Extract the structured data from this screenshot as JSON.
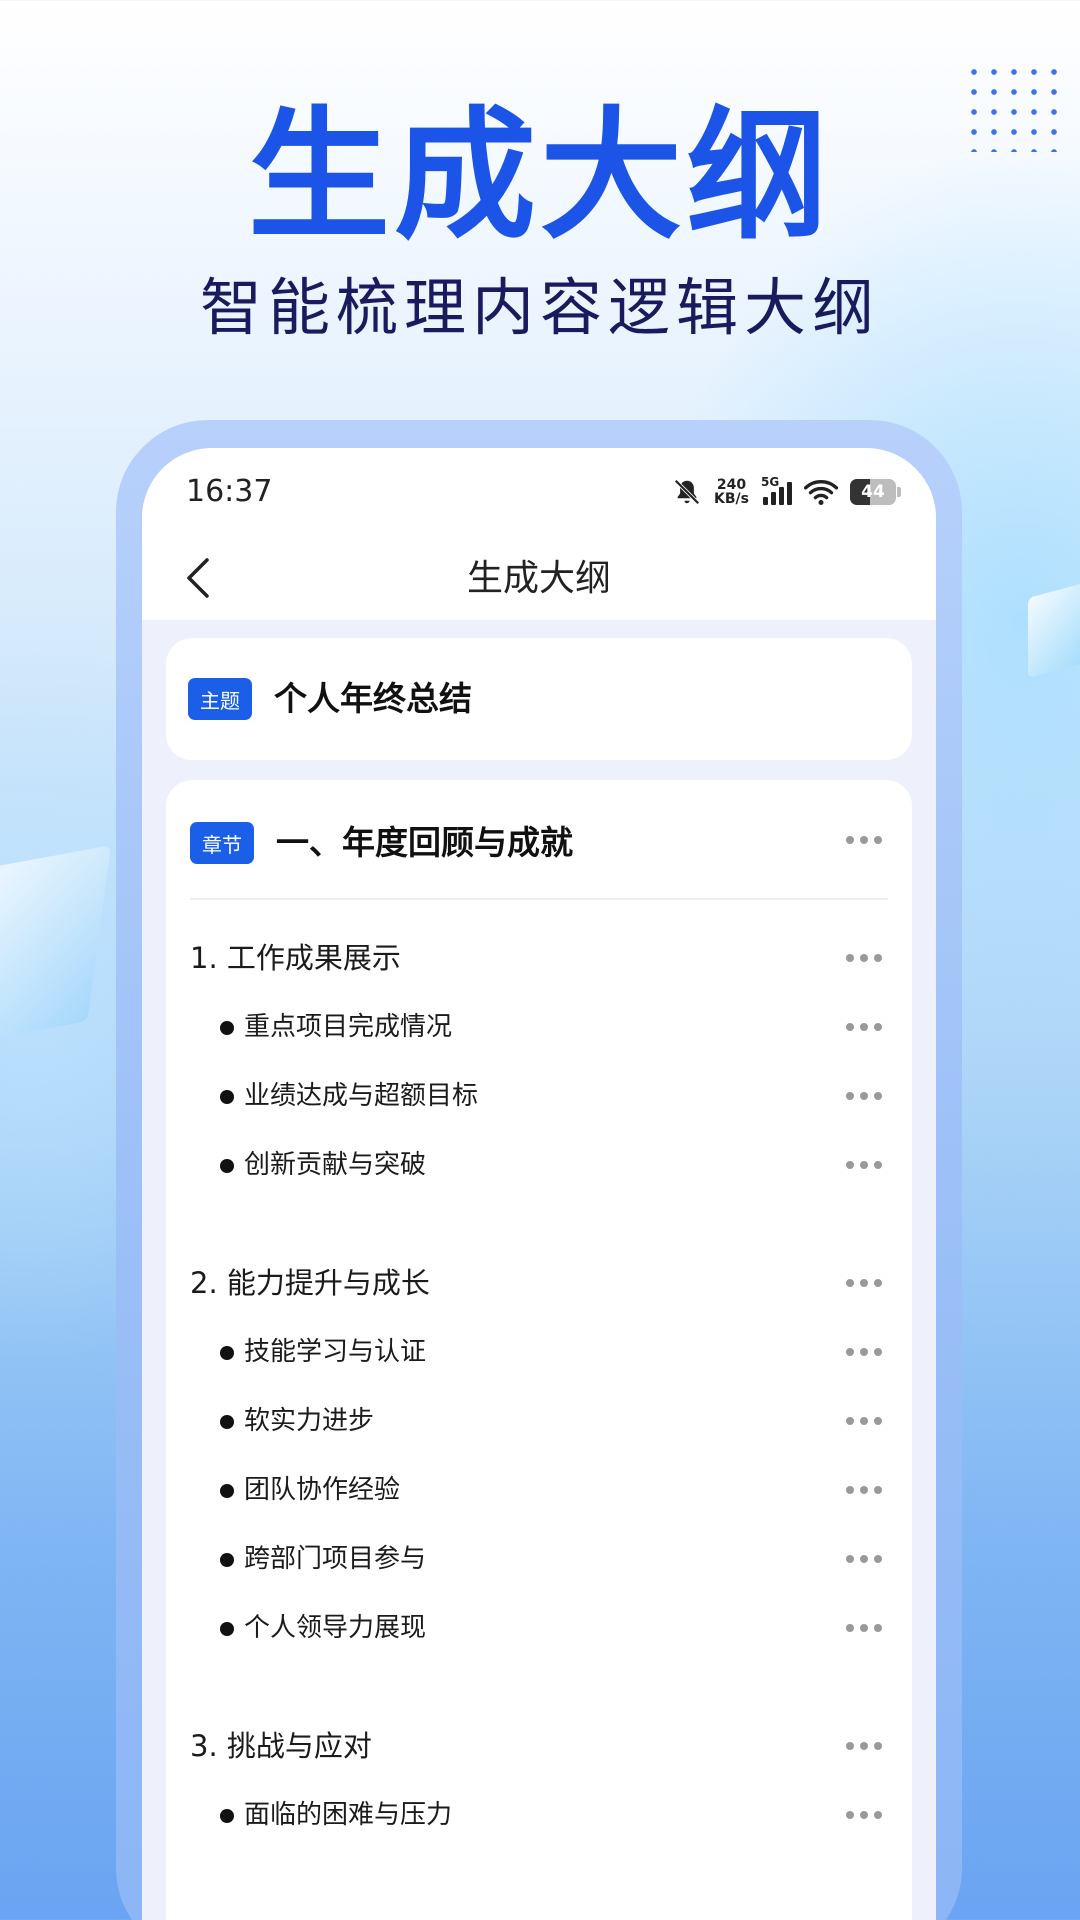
{
  "hero": {
    "title": "生成大纲",
    "subtitle": "智能梳理内容逻辑大纲"
  },
  "status_bar": {
    "time": "16:37",
    "net_speed_value": "240",
    "net_speed_unit": "KB/s",
    "network": "5G",
    "battery": "44",
    "icons": [
      "bell-muted-icon",
      "signal-icon",
      "wifi-icon",
      "battery-icon"
    ]
  },
  "nav": {
    "back_icon": "chevron-left-icon",
    "title": "生成大纲"
  },
  "topic": {
    "tag": "主题",
    "text": "个人年终总结"
  },
  "chapter": {
    "tag": "章节",
    "title": "一、年度回顾与成就",
    "sections": [
      {
        "label": "1. 工作成果展示",
        "items": [
          "重点项目完成情况",
          "业绩达成与超额目标",
          "创新贡献与突破"
        ]
      },
      {
        "label": "2. 能力提升与成长",
        "items": [
          "技能学习与认证",
          "软实力进步",
          "团队协作经验",
          "跨部门项目参与",
          "个人领导力展现"
        ]
      },
      {
        "label": "3. 挑战与应对",
        "items": [
          "面临的困难与压力"
        ]
      }
    ]
  },
  "colors": {
    "brand": "#1b54e6",
    "tag": "#1b5fe8",
    "subtitle": "#1a1a5e"
  }
}
